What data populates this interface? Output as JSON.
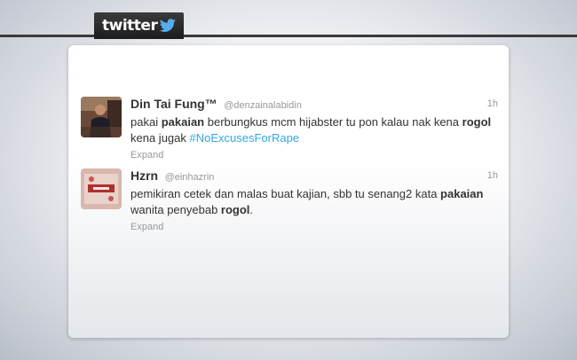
{
  "header": {
    "logo_text": "twitter",
    "brand_color": "#55acee"
  },
  "tweets": [
    {
      "name": "Din Tai Fung™",
      "handle": "@denzainalabidin",
      "time": "1h",
      "text_1": "pakai ",
      "bold_1": "pakaian",
      "text_2": " berbungkus mcm hijabster tu pon kalau nak kena ",
      "bold_2": "rogol",
      "text_3": " kena jugak ",
      "hashtag": "#NoExcusesForRape",
      "expand_label": "Expand"
    },
    {
      "name": "Hzrn",
      "handle": "@einhazrin",
      "time": "1h",
      "text_1": "pemikiran cetek dan malas buat kajian, sbb tu senang2 kata ",
      "bold_1": "pakaian",
      "text_2": " wanita penyebab ",
      "bold_2": "rogol",
      "text_3": ".",
      "expand_label": "Expand"
    }
  ]
}
